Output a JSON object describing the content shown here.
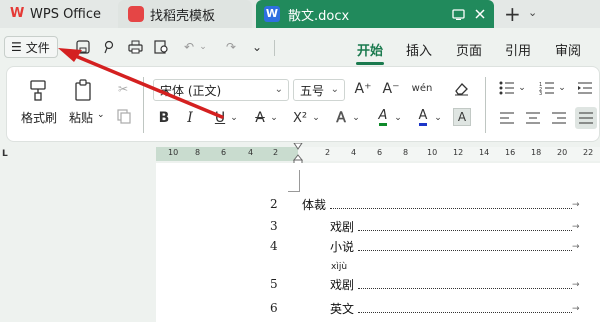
{
  "tabs": {
    "app_name": "WPS Office",
    "template_tab": "找稻壳模板",
    "doc_tab": "散文.docx",
    "doc_icon_letter": "W"
  },
  "quick": {
    "file_label": "文件"
  },
  "menu": {
    "items": [
      "开始",
      "插入",
      "页面",
      "引用",
      "审阅"
    ],
    "active": "开始"
  },
  "ribbon": {
    "format_painter": "格式刷",
    "paste": "粘贴",
    "font_name": "宋体 (正文)",
    "font_size": "五号",
    "bold": "B",
    "italic": "I",
    "underline": "U",
    "strike": "A",
    "superscript": "X²",
    "text_effect": "A",
    "highlight": "A",
    "font_color": "A",
    "char_shade": "A",
    "grow": "A⁺",
    "shrink": "A⁻",
    "phonetic": "wén",
    "colors": {
      "accent": "#1a7a4e",
      "highlight": "#0f8a2a",
      "font_color": "#1c36c8",
      "doc_tab": "#218a5c",
      "arrow": "#d42020"
    }
  },
  "ruler": {
    "left_marks": [
      "10",
      "8",
      "6",
      "4",
      "2"
    ],
    "right_marks": [
      "2",
      "4",
      "6",
      "8",
      "10",
      "12",
      "14",
      "16",
      "18",
      "20",
      "22"
    ],
    "corner": "L"
  },
  "document": {
    "toc": [
      {
        "num": "2",
        "text": "体裁",
        "level": 1
      },
      {
        "num": "3",
        "text": "戏剧",
        "level": 2
      },
      {
        "num": "4",
        "text": "小说",
        "level": 2
      },
      {
        "num": "5",
        "text": "戏剧",
        "level": 2,
        "pinyin": "xìjù"
      },
      {
        "num": "6",
        "text": "英文",
        "level": 2
      }
    ]
  }
}
